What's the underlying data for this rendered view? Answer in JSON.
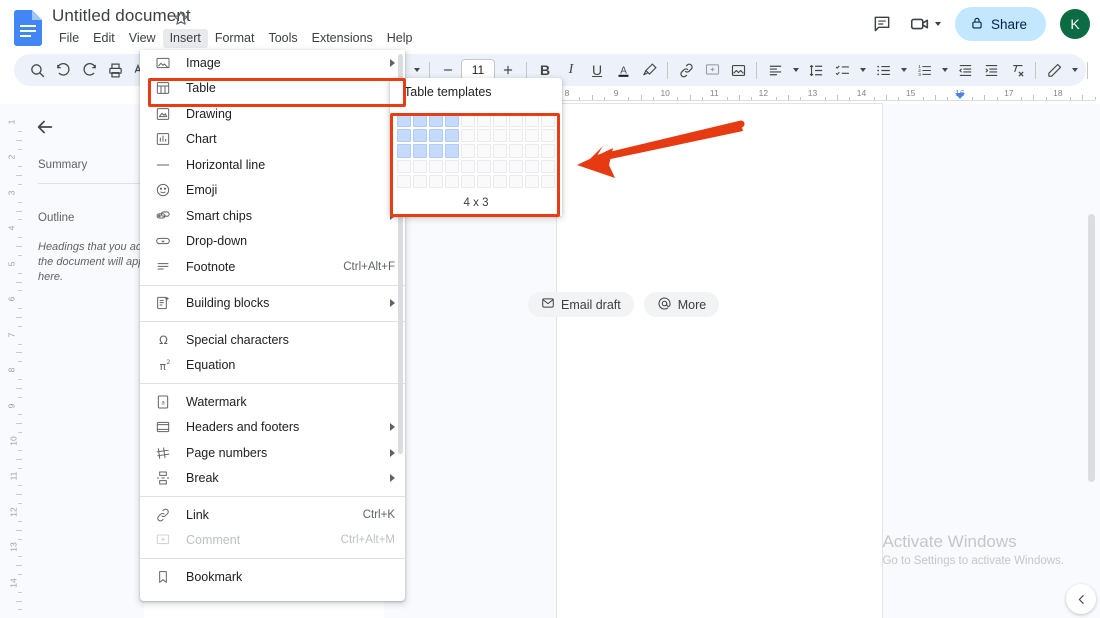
{
  "app": {
    "doc_title": "Untitled document",
    "logo_name": "google-docs-logo",
    "avatar_initial": "K"
  },
  "menubar": {
    "items": [
      {
        "label": "File",
        "active": false
      },
      {
        "label": "Edit",
        "active": false
      },
      {
        "label": "View",
        "active": false
      },
      {
        "label": "Insert",
        "active": true
      },
      {
        "label": "Format",
        "active": false
      },
      {
        "label": "Tools",
        "active": false
      },
      {
        "label": "Extensions",
        "active": false
      },
      {
        "label": "Help",
        "active": false
      }
    ]
  },
  "topright": {
    "comment_history_icon": "comment-icon",
    "meeting_icon": "video-camera-icon",
    "share_label": "Share",
    "share_icon": "lock-icon",
    "share_bg": "#c2e7ff"
  },
  "toolbar": {
    "font_size": "11",
    "icons": [
      "search-icon",
      "undo-icon",
      "redo-icon",
      "print-icon",
      "spellcheck-icon",
      "paint-format-icon",
      "zoom-select",
      "font-select",
      "decrease-font-icon",
      "increase-font-icon",
      "bold-icon",
      "italic-icon",
      "underline-icon",
      "text-color-icon",
      "highlight-icon",
      "link-icon",
      "comment-icon",
      "image-icon",
      "align-icon",
      "line-spacing-icon",
      "checklist-icon",
      "bulleted-list-icon",
      "numbered-list-icon",
      "decrease-indent-icon",
      "increase-indent-icon",
      "clear-formatting-icon",
      "edit-mode-icon",
      "collapse-toolbar-icon"
    ]
  },
  "ruler": {
    "horizontal_numbers": [
      "8",
      "9",
      "10",
      "11",
      "12",
      "13",
      "14",
      "15",
      "16",
      "17",
      "18"
    ],
    "vertical_numbers": [
      "1",
      "2",
      "3",
      "4",
      "5",
      "6",
      "7",
      "8",
      "9",
      "10",
      "11",
      "12",
      "13",
      "14"
    ],
    "indent_marker_at": "16"
  },
  "outline_pane": {
    "back_icon": "back-arrow-icon",
    "summary_label": "Summary",
    "outline_label": "Outline",
    "empty_hint": "Headings that you add to the document will appear here."
  },
  "insert_menu": {
    "groups": [
      {
        "items": [
          {
            "label": "Image",
            "icon": "image-icon",
            "arrow": true,
            "accel": "",
            "disabled": false,
            "highlighted": false
          },
          {
            "label": "Table",
            "icon": "table-icon",
            "arrow": true,
            "accel": "",
            "disabled": false,
            "highlighted": true
          },
          {
            "label": "Drawing",
            "icon": "drawing-icon",
            "arrow": true,
            "accel": "",
            "disabled": false,
            "highlighted": false
          },
          {
            "label": "Chart",
            "icon": "chart-icon",
            "arrow": true,
            "accel": "",
            "disabled": false,
            "highlighted": false
          },
          {
            "label": "Horizontal line",
            "icon": "horizontal-line-icon",
            "arrow": false,
            "accel": "",
            "disabled": false,
            "highlighted": false
          },
          {
            "label": "Emoji",
            "icon": "emoji-icon",
            "arrow": false,
            "accel": "",
            "disabled": false,
            "highlighted": false
          },
          {
            "label": "Smart chips",
            "icon": "smart-chips-icon",
            "arrow": true,
            "accel": "",
            "disabled": false,
            "highlighted": false
          },
          {
            "label": "Drop-down",
            "icon": "drop-down-icon",
            "arrow": false,
            "accel": "",
            "disabled": false,
            "highlighted": false
          },
          {
            "label": "Footnote",
            "icon": "footnote-icon",
            "arrow": false,
            "accel": "Ctrl+Alt+F",
            "disabled": false,
            "highlighted": false
          }
        ]
      },
      {
        "items": [
          {
            "label": "Building blocks",
            "icon": "building-blocks-icon",
            "arrow": true,
            "accel": "",
            "disabled": false,
            "highlighted": false
          }
        ]
      },
      {
        "items": [
          {
            "label": "Special characters",
            "icon": "omega-icon",
            "arrow": false,
            "accel": "",
            "disabled": false,
            "highlighted": false
          },
          {
            "label": "Equation",
            "icon": "equation-icon",
            "arrow": false,
            "accel": "",
            "disabled": false,
            "highlighted": false
          }
        ]
      },
      {
        "items": [
          {
            "label": "Watermark",
            "icon": "watermark-icon",
            "arrow": false,
            "accel": "",
            "disabled": false,
            "highlighted": false
          },
          {
            "label": "Headers and footers",
            "icon": "headers-footers-icon",
            "arrow": true,
            "accel": "",
            "disabled": false,
            "highlighted": false
          },
          {
            "label": "Page numbers",
            "icon": "page-numbers-icon",
            "arrow": true,
            "accel": "",
            "disabled": false,
            "highlighted": false
          },
          {
            "label": "Break",
            "icon": "break-icon",
            "arrow": true,
            "accel": "",
            "disabled": false,
            "highlighted": false
          }
        ]
      },
      {
        "items": [
          {
            "label": "Link",
            "icon": "link-icon",
            "arrow": false,
            "accel": "Ctrl+K",
            "disabled": false,
            "highlighted": false
          },
          {
            "label": "Comment",
            "icon": "comment-icon",
            "arrow": false,
            "accel": "Ctrl+Alt+M",
            "disabled": true,
            "highlighted": false
          }
        ]
      },
      {
        "items": [
          {
            "label": "Bookmark",
            "icon": "bookmark-icon",
            "arrow": false,
            "accel": "",
            "disabled": false,
            "highlighted": false
          }
        ]
      }
    ]
  },
  "table_submenu": {
    "templates_label": "Table templates",
    "grid": {
      "columns": 10,
      "rows": 5,
      "selected_cols": 4,
      "selected_rows": 3,
      "caption": "4 x 3",
      "selected_color": "#c6dafc"
    }
  },
  "suggestion_chips": [
    {
      "label": "Email draft",
      "icon": "email-draft-icon"
    },
    {
      "label": "More",
      "icon": "at-sign-icon"
    }
  ],
  "annotations": {
    "highlight_color": "#ea3c12",
    "boxes": [
      {
        "name": "table-menu-item-highlight"
      },
      {
        "name": "table-grid-picker-highlight"
      }
    ],
    "arrow": {
      "name": "pointer-arrow",
      "direction": "left"
    }
  },
  "watermark": {
    "line1": "Activate Windows",
    "line2": "Go to Settings to activate Windows."
  },
  "fab": {
    "icon": "chevron-left-icon"
  }
}
